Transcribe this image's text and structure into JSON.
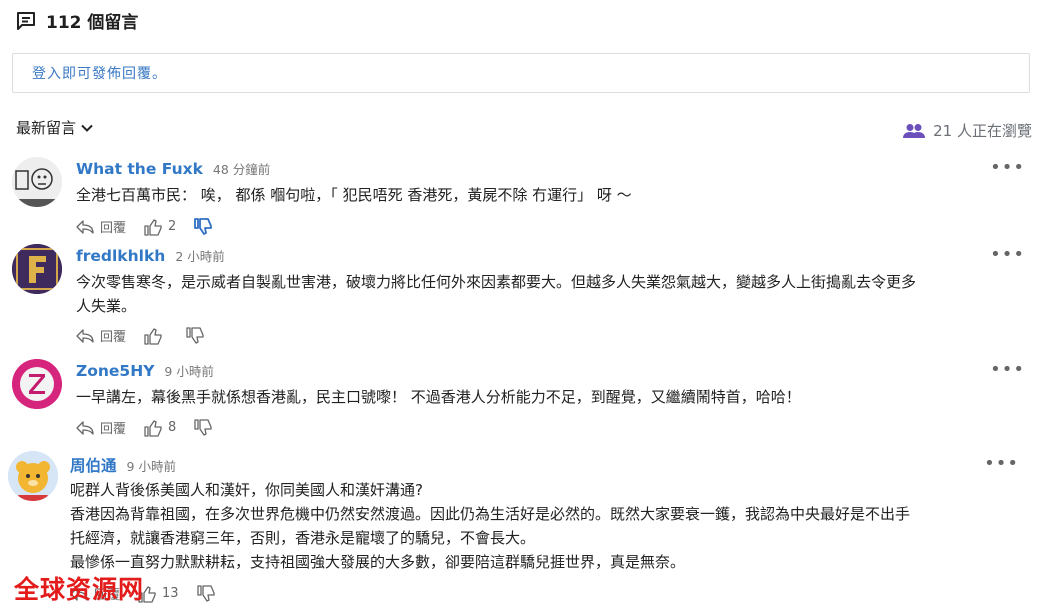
{
  "header": {
    "count_title": "112 個留言"
  },
  "login": {
    "prompt": "登入即可發佈回覆。"
  },
  "sort": {
    "label": "最新留言"
  },
  "viewers": {
    "text": "21 人正在瀏覽",
    "icon_color": "#6b4fbb"
  },
  "colors": {
    "name": "#3178c6",
    "accent_thumb": "#2f6fc4"
  },
  "comments": [
    {
      "name": "What the Fuxk",
      "time": "48 分鐘前",
      "lines": [
        "全港七百萬市民： 唉， 都係 嗰句啦，「 犯民唔死 香港死，黃屍不除 冇運行」 呀 ～"
      ],
      "reply": "回覆",
      "likes": "2",
      "dislike_active": true
    },
    {
      "name": "fredlkhlkh",
      "time": "2 小時前",
      "lines": [
        "今次零售寒冬，是示威者自製亂世害港，破壞力將比任何外來因素都要大。但越多人失業怨氣越大，變越多人上街搗亂去令更多",
        "人失業。"
      ],
      "reply": "回覆",
      "likes": "",
      "dislike_active": false
    },
    {
      "name": "Zone5HY",
      "time": "9 小時前",
      "lines": [
        "一早講左，幕後黑手就係想香港亂，民主口號嚟！ 不過香港人分析能力不足，到醒覺，又繼續鬧特首，哈哈！"
      ],
      "reply": "回覆",
      "likes": "8",
      "dislike_active": false
    },
    {
      "name": "周伯通",
      "time": "9 小時前",
      "lines": [
        "呢群人背後係美國人和漢奸，你同美國人和漢奸溝通?",
        "香港因為背靠祖國，在多次世界危機中仍然安然渡過。因此仍為生活好是必然的。既然大家要衰一鑊，我認為中央最好是不出手",
        "托經濟，就讓香港窮三年，否則，香港永是寵壞了的驕兒，不會長大。",
        "最慘係一直努力默默耕耘，支持祖國強大發展的大多數，卻要陪這群驕兒捱世界，真是無奈。"
      ],
      "reply": "回覆",
      "likes": "13",
      "dislike_active": false
    }
  ],
  "watermark": "全球资源网"
}
